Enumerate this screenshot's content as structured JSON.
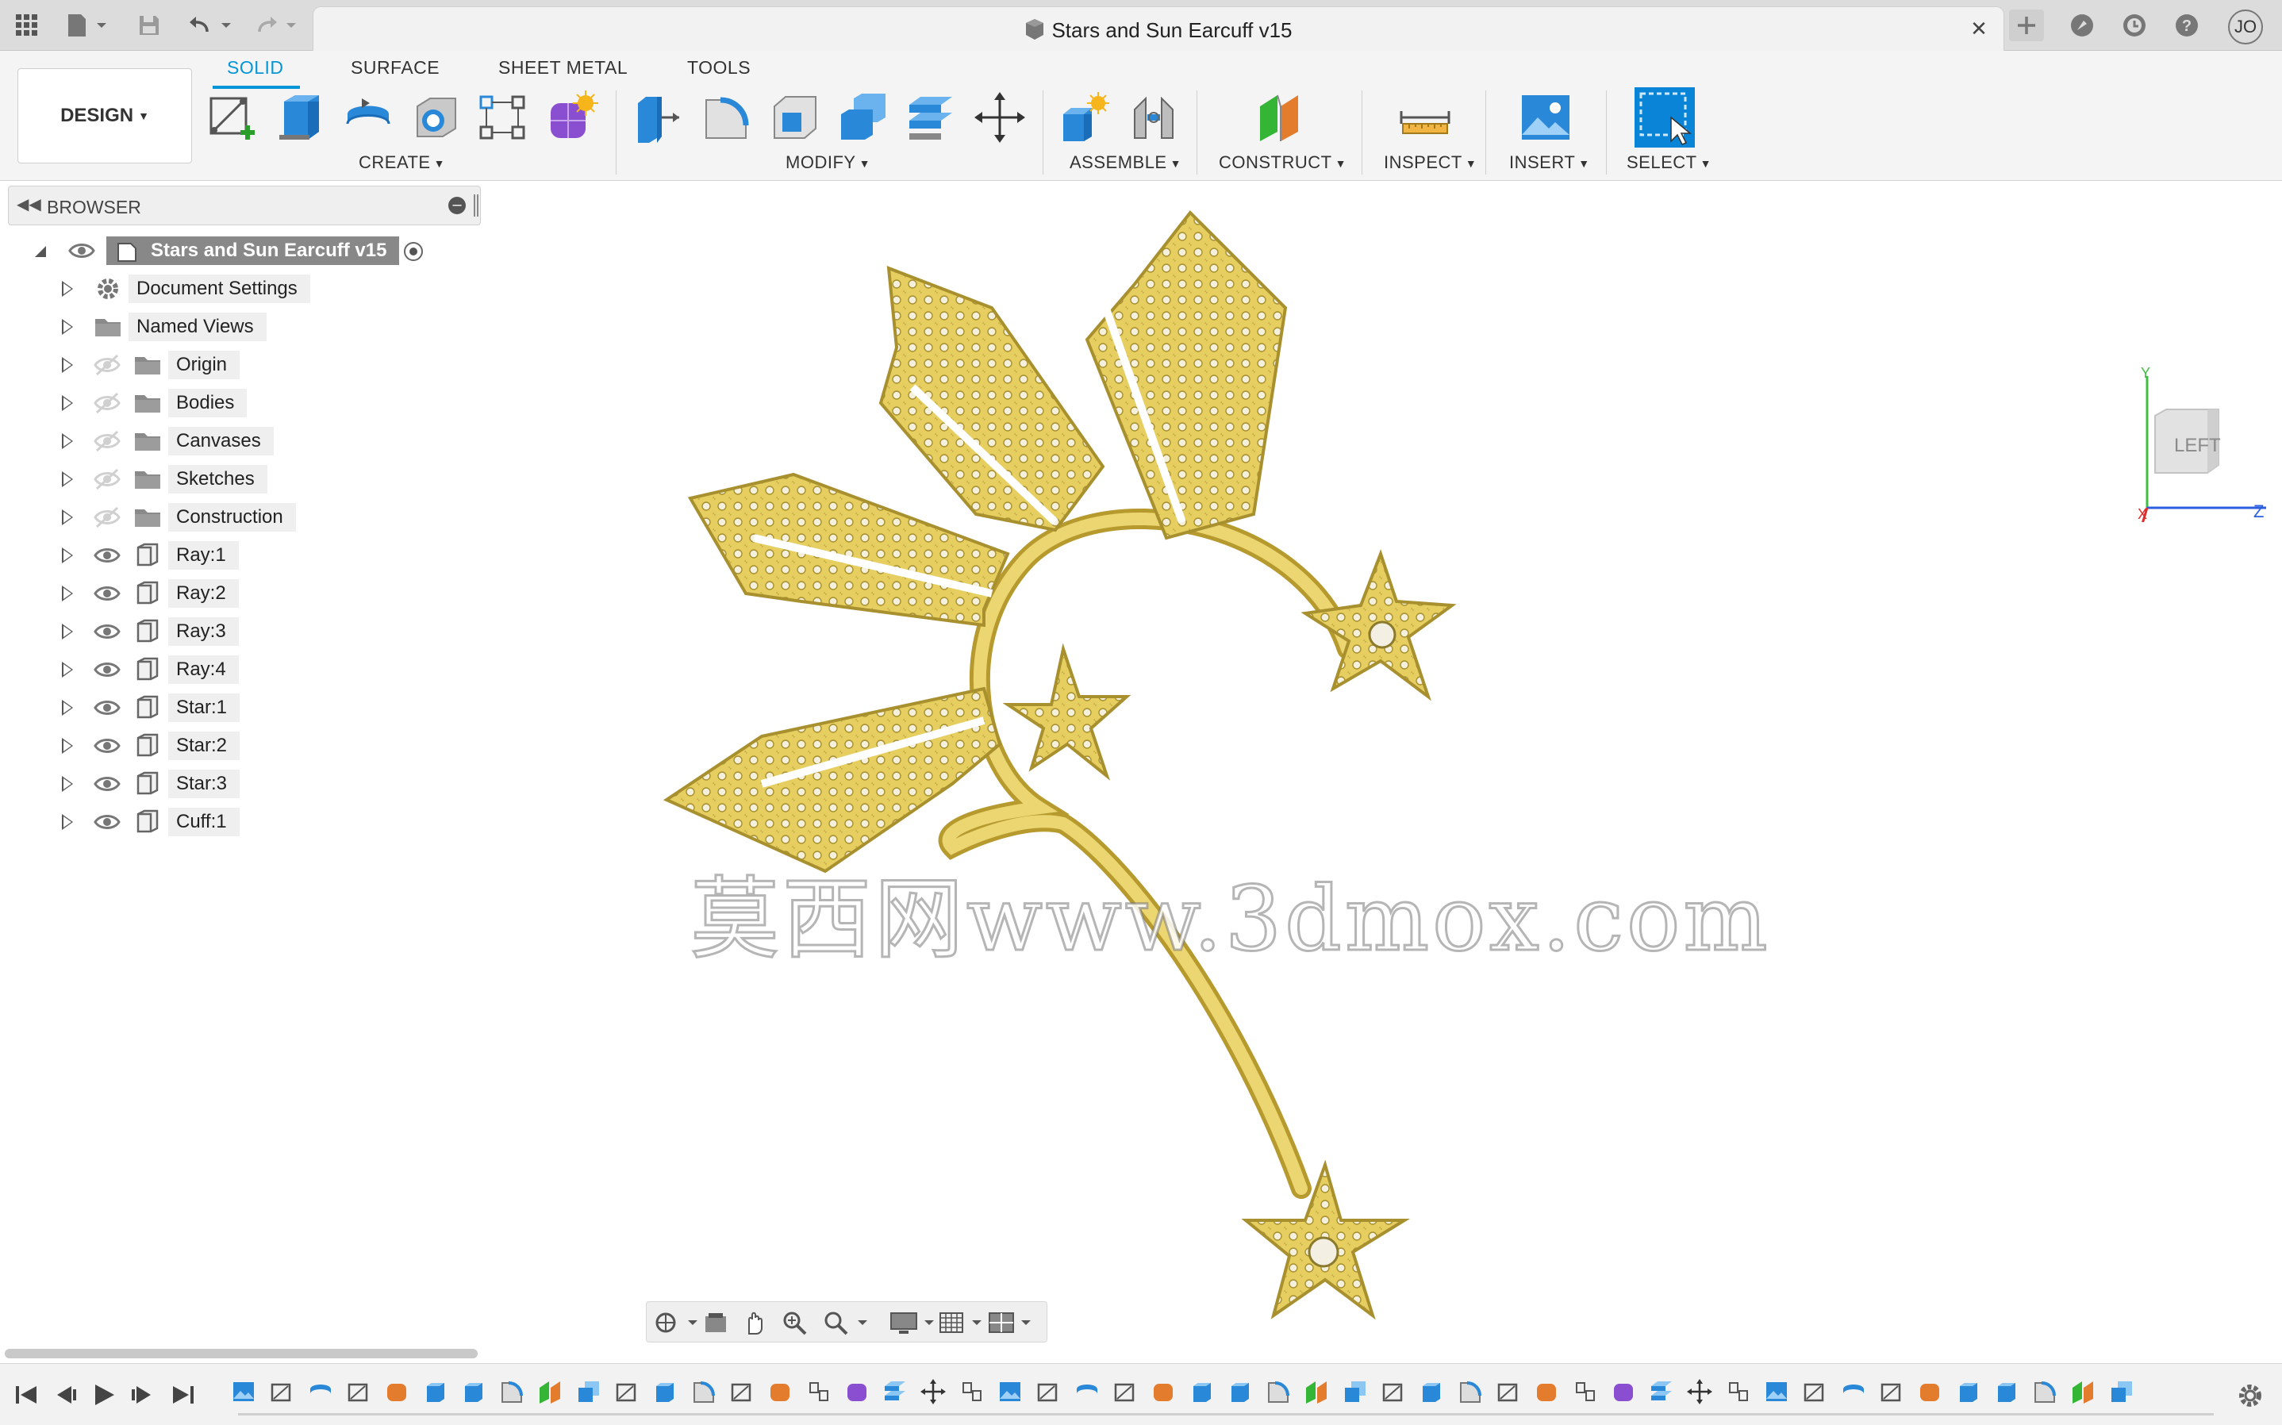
{
  "app": {
    "document_title": "Stars and Sun Earcuff v15",
    "user_initials": "JO"
  },
  "ribbon": {
    "workspace": "DESIGN",
    "tabs": [
      "SOLID",
      "SURFACE",
      "SHEET METAL",
      "TOOLS"
    ],
    "active_tab": "SOLID",
    "groups": [
      "CREATE",
      "MODIFY",
      "ASSEMBLE",
      "CONSTRUCT",
      "INSPECT",
      "INSERT",
      "SELECT"
    ]
  },
  "browser": {
    "title": "BROWSER",
    "root": "Stars and Sun Earcuff v15",
    "items": [
      {
        "label": "Document Settings",
        "icon": "gear-icon",
        "visible": null
      },
      {
        "label": "Named Views",
        "icon": "folder-icon",
        "visible": null
      },
      {
        "label": "Origin",
        "icon": "folder-icon",
        "visible": false
      },
      {
        "label": "Bodies",
        "icon": "folder-icon",
        "visible": false
      },
      {
        "label": "Canvases",
        "icon": "folder-icon",
        "visible": false
      },
      {
        "label": "Sketches",
        "icon": "folder-icon",
        "visible": false
      },
      {
        "label": "Construction",
        "icon": "folder-icon",
        "visible": false
      },
      {
        "label": "Ray:1",
        "icon": "component-icon",
        "visible": true
      },
      {
        "label": "Ray:2",
        "icon": "component-icon",
        "visible": true
      },
      {
        "label": "Ray:3",
        "icon": "component-icon",
        "visible": true
      },
      {
        "label": "Ray:4",
        "icon": "component-icon",
        "visible": true
      },
      {
        "label": "Star:1",
        "icon": "component-icon",
        "visible": true
      },
      {
        "label": "Star:2",
        "icon": "component-icon",
        "visible": true
      },
      {
        "label": "Star:3",
        "icon": "component-icon",
        "visible": true
      },
      {
        "label": "Cuff:1",
        "icon": "component-icon",
        "visible": true
      }
    ]
  },
  "viewport": {
    "watermark": "莫西网www.3dmox.com",
    "viewcube_face": "LEFT",
    "axis_z": "Z",
    "axis_x": "X",
    "axis_y": "Y",
    "model_color": "#e9d36b"
  },
  "colors": {
    "accent": "#0696d7",
    "gold": "#e6cf60",
    "gold_dark": "#b79a2e"
  }
}
